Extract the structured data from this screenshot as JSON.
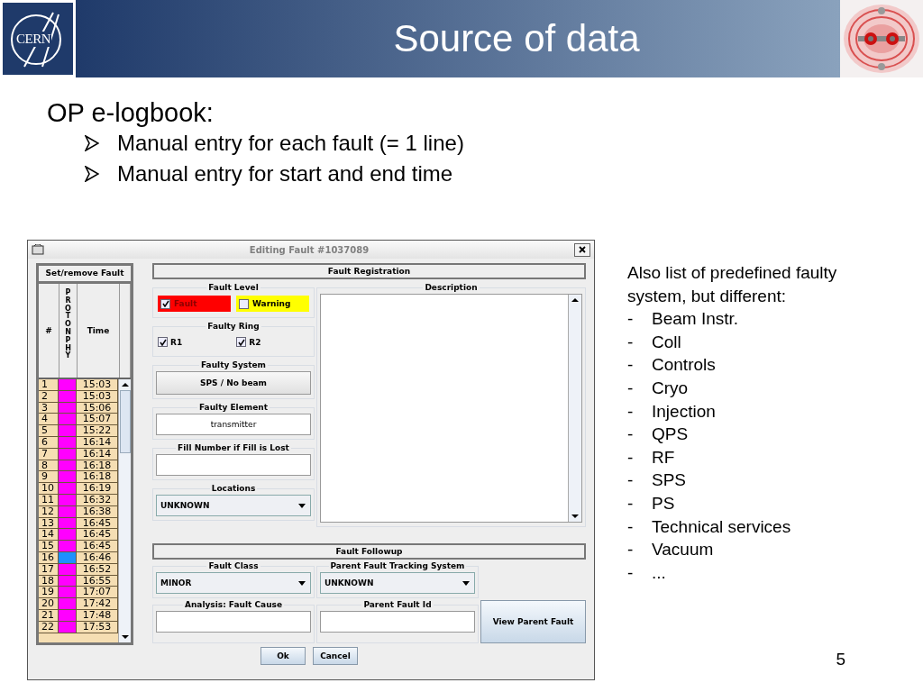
{
  "header": {
    "logo_text": "CERN",
    "title": "Source of data"
  },
  "heading": "OP e-logbook:",
  "bullets": [
    "Manual entry for each fault (= 1 line)",
    "Manual entry for start and end time"
  ],
  "window": {
    "title": "Editing Fault #1037089",
    "left_panel": {
      "title": "Set/remove Fault",
      "columns": [
        "#",
        "PROTONPHY",
        "Time"
      ],
      "rows": [
        {
          "num": "1",
          "color": "#ff00ff",
          "time": "15:03"
        },
        {
          "num": "2",
          "color": "#ff00ff",
          "time": "15:03"
        },
        {
          "num": "3",
          "color": "#ff00ff",
          "time": "15:06"
        },
        {
          "num": "4",
          "color": "#ff00ff",
          "time": "15:07"
        },
        {
          "num": "5",
          "color": "#ff00ff",
          "time": "15:22"
        },
        {
          "num": "6",
          "color": "#ff00ff",
          "time": "16:14"
        },
        {
          "num": "7",
          "color": "#ff00ff",
          "time": "16:14"
        },
        {
          "num": "8",
          "color": "#ff00ff",
          "time": "16:18"
        },
        {
          "num": "9",
          "color": "#ff00ff",
          "time": "16:18"
        },
        {
          "num": "10",
          "color": "#ff00ff",
          "time": "16:19"
        },
        {
          "num": "11",
          "color": "#ff00ff",
          "time": "16:32"
        },
        {
          "num": "12",
          "color": "#ff00ff",
          "time": "16:38"
        },
        {
          "num": "13",
          "color": "#ff00ff",
          "time": "16:45"
        },
        {
          "num": "14",
          "color": "#ff00ff",
          "time": "16:45"
        },
        {
          "num": "15",
          "color": "#ff00ff",
          "time": "16:45"
        },
        {
          "num": "16",
          "color": "#1e90ff",
          "time": "16:46"
        },
        {
          "num": "17",
          "color": "#ff00ff",
          "time": "16:52"
        },
        {
          "num": "18",
          "color": "#ff00ff",
          "time": "16:55"
        },
        {
          "num": "19",
          "color": "#ff00ff",
          "time": "17:07"
        },
        {
          "num": "20",
          "color": "#ff00ff",
          "time": "17:42"
        },
        {
          "num": "21",
          "color": "#ff00ff",
          "time": "17:48"
        },
        {
          "num": "22",
          "color": "#ff00ff",
          "time": "17:53"
        }
      ]
    },
    "registration": {
      "title": "Fault Registration",
      "fault_level": {
        "label": "Fault Level",
        "options": [
          {
            "label": "Fault",
            "checked": true,
            "color": "#ff0000"
          },
          {
            "label": "Warning",
            "checked": false,
            "color": "#ffff00"
          }
        ]
      },
      "faulty_ring": {
        "label": "Faulty Ring",
        "options": [
          {
            "label": "R1",
            "checked": true
          },
          {
            "label": "R2",
            "checked": true
          }
        ]
      },
      "faulty_system": {
        "label": "Faulty System",
        "button": "SPS / No beam"
      },
      "faulty_element": {
        "label": "Faulty Element",
        "value": "transmitter"
      },
      "fill_number": {
        "label": "Fill Number if Fill is Lost"
      },
      "locations": {
        "label": "Locations",
        "value": "UNKNOWN"
      },
      "description": {
        "label": "Description"
      }
    },
    "followup": {
      "title": "Fault Followup",
      "fault_class": {
        "label": "Fault Class",
        "value": "MINOR"
      },
      "parent_tracking": {
        "label": "Parent Fault Tracking System",
        "value": "UNKNOWN"
      },
      "fault_cause": {
        "label": "Analysis: Fault Cause"
      },
      "parent_id": {
        "label": "Parent Fault Id"
      },
      "view_button": "View Parent Fault"
    },
    "buttons": [
      "Ok",
      "Cancel"
    ]
  },
  "side_note": {
    "intro": "Also list of predefined faulty system, but different:",
    "items": [
      {
        "marker": "-",
        "text": "Beam Instr."
      },
      {
        "marker": "-",
        "text": "Coll"
      },
      {
        "marker": "-",
        "text": "Controls"
      },
      {
        "marker": "-",
        "text": "Cryo"
      },
      {
        "marker": "-",
        "text": "Injection"
      },
      {
        "marker": "-",
        "text": "QPS"
      },
      {
        "marker": "-",
        "text": "RF"
      },
      {
        "marker": "-",
        "text": "SPS"
      },
      {
        "marker": "-",
        "text": "PS"
      },
      {
        "marker": "-",
        "text": "Technical services"
      },
      {
        "marker": "-",
        "text": "Vacuum"
      },
      {
        "marker": "-",
        "text": "..."
      }
    ]
  },
  "page_number": "5"
}
